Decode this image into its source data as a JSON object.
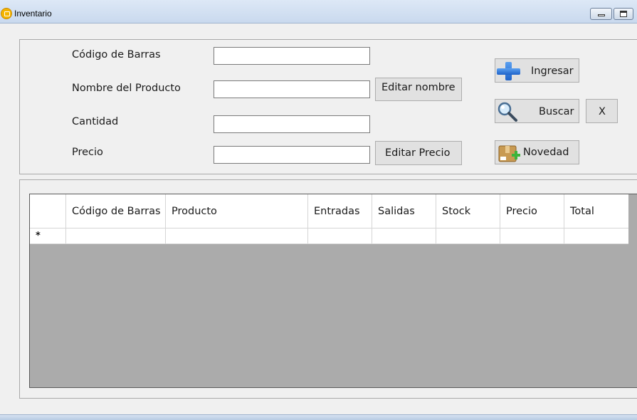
{
  "window": {
    "title": "Inventario"
  },
  "form": {
    "codigo_label": "Código de Barras",
    "nombre_label": "Nombre del Producto",
    "cantidad_label": "Cantidad",
    "precio_label": "Precio",
    "codigo_value": "",
    "nombre_value": "",
    "cantidad_value": "",
    "precio_value": ""
  },
  "buttons": {
    "editar_nombre": "Editar nombre",
    "editar_precio": "Editar Precio",
    "ingresar": "Ingresar",
    "buscar": "Buscar",
    "clear": "X",
    "novedad": "Novedad"
  },
  "grid": {
    "columns": [
      "Código de Barras",
      "Producto",
      "Entradas",
      "Salidas",
      "Stock",
      "Precio",
      "Total"
    ],
    "new_row_marker": "*",
    "rows": []
  },
  "colors": {
    "window_bg": "#f0f0f0",
    "grid_empty_bg": "#ababab",
    "plus_icon_blue": "#1f63c9"
  }
}
